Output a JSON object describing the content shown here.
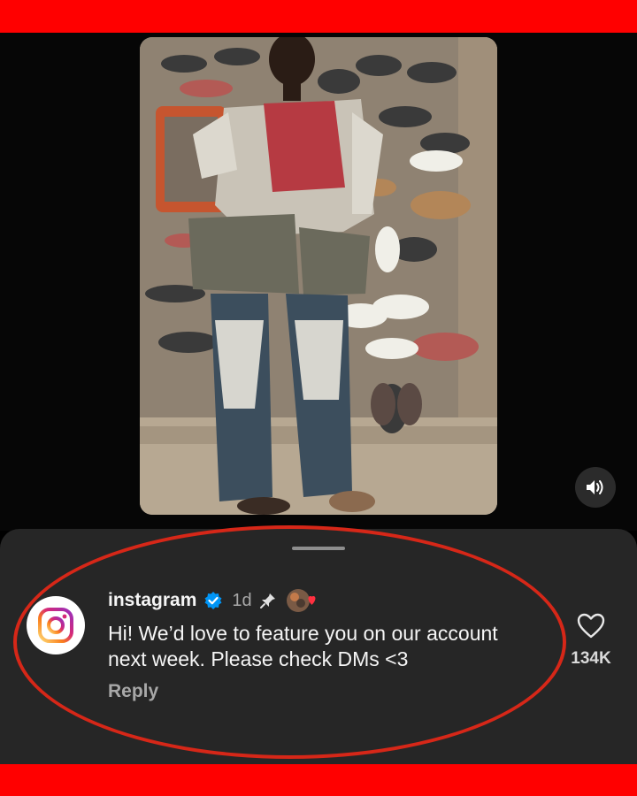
{
  "post": {
    "image_description_icon": "photo-icon",
    "sound_icon": "speaker-icon"
  },
  "comment": {
    "username": "instagram",
    "verified_icon": "verified-badge-icon",
    "timestamp": "1d",
    "pinned_icon": "pin-icon",
    "text": "Hi! We’d love to feature you on our account next week. Please check DMs <3",
    "reply_label": "Reply",
    "like_count": "134K"
  },
  "colors": {
    "red_bar": "#ff0000",
    "sheet_bg": "#262626",
    "verified_blue": "#0095f6",
    "highlight_oval": "#d62718"
  }
}
